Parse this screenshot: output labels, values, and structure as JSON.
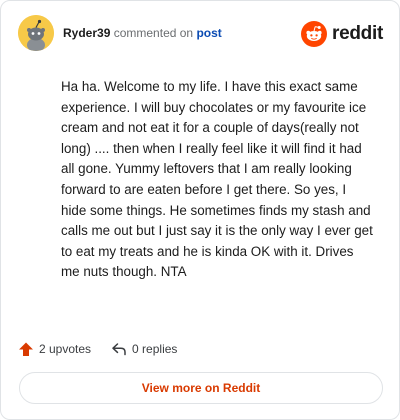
{
  "header": {
    "username": "Ryder39",
    "action_text": "commented on",
    "target_text": "post",
    "brand_name": "reddit",
    "brand_color": "#ff4500",
    "avatar_color": "#f7c948"
  },
  "comment": {
    "text": "Ha ha. Welcome to my life. I have this exact same experience. I will buy chocolates or my favourite ice cream and not eat it for a couple of days(really not long) .... then when I really feel like it will find it had all gone. Yummy leftovers that I am really looking forward to are eaten before I get there. So yes, I hide some things. He sometimes finds my stash and calls me out but I just say it is the only way I ever get to eat my treats and he is kinda OK with it. Drives me nuts though. NTA"
  },
  "stats": {
    "upvotes_label": "2 upvotes",
    "replies_label": "0 replies",
    "upvote_icon": "upvote-arrow-icon",
    "reply_icon": "reply-arrow-icon"
  },
  "footer": {
    "view_more_label": "View more on Reddit",
    "accent_color": "#d93a00"
  }
}
